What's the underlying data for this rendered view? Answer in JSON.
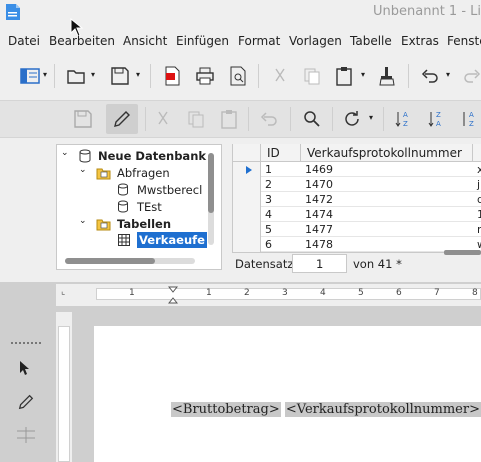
{
  "window": {
    "title": "Unbenannt 1 - Li"
  },
  "menu": [
    "Datei",
    "Bearbeiten",
    "Ansicht",
    "Einfügen",
    "Format",
    "Vorlagen",
    "Tabelle",
    "Extras",
    "Fenste"
  ],
  "tree": {
    "root": "Neue Datenbank",
    "queries_label": "Abfragen",
    "queries": [
      "Mwstberecl",
      "TEst"
    ],
    "tables_label": "Tabellen",
    "tables": [
      "Verkaeufe"
    ]
  },
  "grid": {
    "columns": [
      "ID",
      "Verkaufsprotokollnummer"
    ],
    "rows": [
      {
        "id": "1",
        "nr": "1469",
        "extra": "x"
      },
      {
        "id": "2",
        "nr": "1470",
        "extra": "ji"
      },
      {
        "id": "3",
        "nr": "1472",
        "extra": "d"
      },
      {
        "id": "4",
        "nr": "1474",
        "extra": "1"
      },
      {
        "id": "5",
        "nr": "1477",
        "extra": "n"
      },
      {
        "id": "6",
        "nr": "1478",
        "extra": "w"
      }
    ]
  },
  "navigator": {
    "label": "Datensatz",
    "current": "1",
    "of_text": "von 41 *"
  },
  "ruler": {
    "ticks": [
      "1",
      "1",
      "2",
      "3",
      "4",
      "5",
      "6",
      "7",
      "8"
    ]
  },
  "document": {
    "field1": "<Bruttobetrag>",
    "field2": "<Verkaufsprotokollnummer>"
  },
  "colors": {
    "selection": "#1e6fd0",
    "field_bg": "#c8c8c8",
    "accent": "#2a6fc9"
  }
}
